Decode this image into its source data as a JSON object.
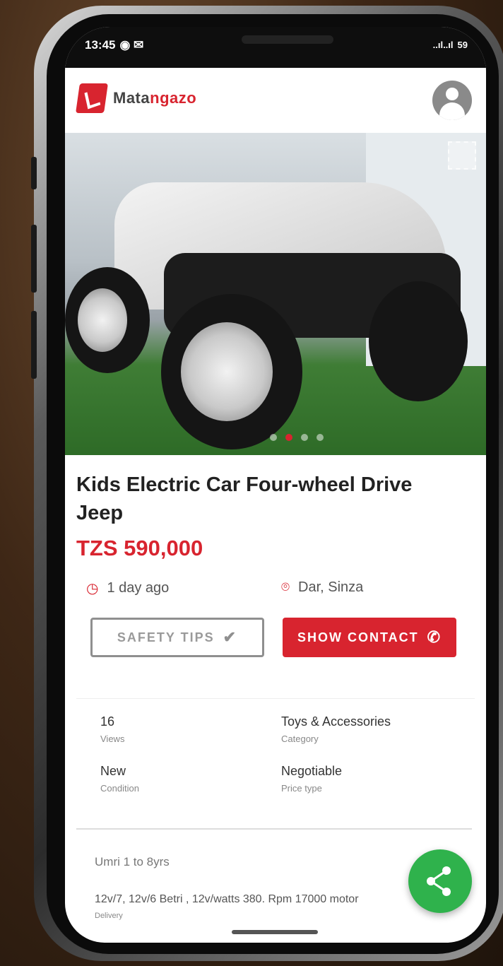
{
  "status": {
    "time": "13:45",
    "indicators": "..ıl..ıl",
    "battery": "59"
  },
  "brand": {
    "name_prefix": "Mata",
    "name_accent": "ngazo",
    "color": "#d8242f"
  },
  "listing": {
    "title": "Kids Electric Car Four-wheel Drive Jeep",
    "price": "TZS 590,000",
    "posted": "1 day ago",
    "location": "Dar, Sinza"
  },
  "buttons": {
    "safety": "SAFETY TIPS",
    "contact": "SHOW CONTACT"
  },
  "details": [
    {
      "value": "16",
      "label": "Views"
    },
    {
      "value": "Toys & Accessories",
      "label": "Category"
    },
    {
      "value": "New",
      "label": "Condition"
    },
    {
      "value": "Negotiable",
      "label": "Price type"
    }
  ],
  "description": {
    "heading": "Umri 1 to 8yrs",
    "text": "12v/7, 12v/6 Betri , 12v/watts 380. Rpm 17000 motor",
    "sub": "Delivery"
  },
  "gallery": {
    "slides": 4,
    "active": 1
  },
  "colors": {
    "accent": "#d8242f",
    "fab": "#2fb24c"
  }
}
